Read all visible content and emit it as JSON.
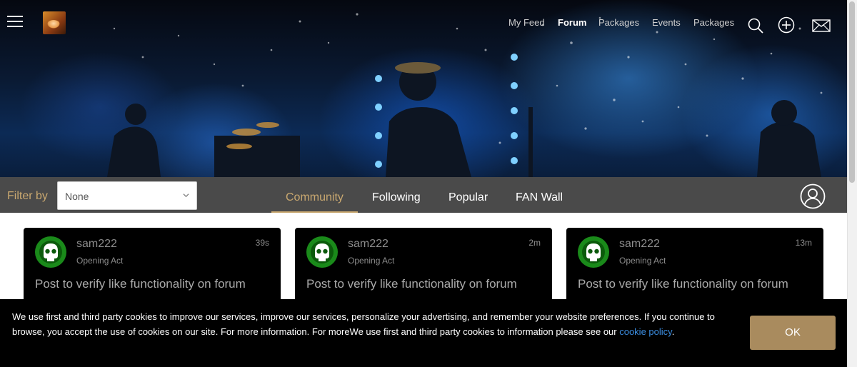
{
  "header": {
    "nav": [
      {
        "label": "My Feed",
        "active": false
      },
      {
        "label": "Forum",
        "active": true
      },
      {
        "label": "Packages",
        "active": false
      },
      {
        "label": "Events",
        "active": false
      },
      {
        "label": "Packages",
        "active": false
      }
    ],
    "icons": [
      "menu-icon",
      "search-icon",
      "plus-circle-icon",
      "mail-icon"
    ]
  },
  "filter": {
    "label": "Filter by",
    "selected": "None"
  },
  "tabs": [
    {
      "label": "Community",
      "active": true
    },
    {
      "label": "Following",
      "active": false
    },
    {
      "label": "Popular",
      "active": false
    },
    {
      "label": "FAN Wall",
      "active": false
    }
  ],
  "posts": [
    {
      "user": "sam222",
      "rank": "Opening Act",
      "time": "39s",
      "title": "Post to verify like functionality on forum"
    },
    {
      "user": "sam222",
      "rank": "Opening Act",
      "time": "2m",
      "title": "Post to verify like functionality on forum"
    },
    {
      "user": "sam222",
      "rank": "Opening Act",
      "time": "13m",
      "title": "Post to verify like functionality on forum"
    }
  ],
  "cookie": {
    "text": "We use first and third party cookies to improve our services, improve our services, personalize your advertising, and remember your website preferences. If you continue to browse, you accept the use of cookies on our site. For more information. For moreWe use first and third party cookies to information please see our ",
    "link": "cookie policy",
    "suffix": ".",
    "button": "OK"
  },
  "colors": {
    "accent": "#c9a870",
    "ok_button": "#a98b5e",
    "filter_bar": "#4a4a4a",
    "avatar_green": "#1a8a1a",
    "link": "#3b8de0"
  }
}
